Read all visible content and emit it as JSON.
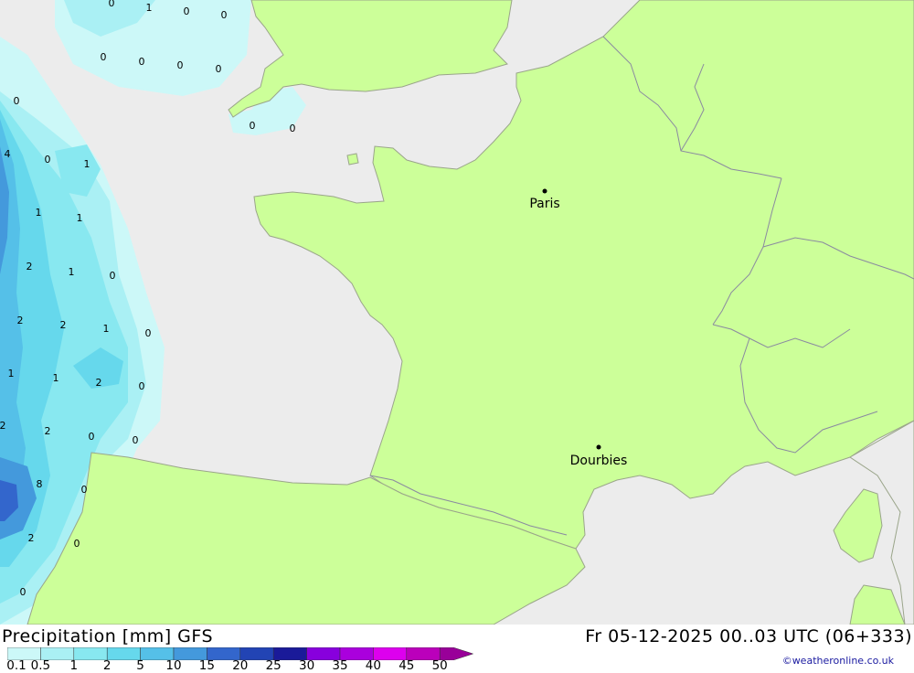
{
  "map": {
    "cities": [
      {
        "name": "Paris"
      },
      {
        "name": "Dourbies"
      }
    ],
    "values": [
      {
        "v": "0"
      },
      {
        "v": "1"
      },
      {
        "v": "0"
      },
      {
        "v": "0"
      },
      {
        "v": "0"
      },
      {
        "v": "0"
      },
      {
        "v": "0"
      },
      {
        "v": "0"
      },
      {
        "v": "0"
      },
      {
        "v": "0"
      },
      {
        "v": "0"
      },
      {
        "v": "4"
      },
      {
        "v": "0"
      },
      {
        "v": "1"
      },
      {
        "v": "1"
      },
      {
        "v": "1"
      },
      {
        "v": "2"
      },
      {
        "v": "1"
      },
      {
        "v": "0"
      },
      {
        "v": "2"
      },
      {
        "v": "2"
      },
      {
        "v": "1"
      },
      {
        "v": "0"
      },
      {
        "v": "1"
      },
      {
        "v": "1"
      },
      {
        "v": "2"
      },
      {
        "v": "0"
      },
      {
        "v": "2"
      },
      {
        "v": "2"
      },
      {
        "v": "0"
      },
      {
        "v": "0"
      },
      {
        "v": "8"
      },
      {
        "v": "0"
      },
      {
        "v": "2"
      },
      {
        "v": "0"
      },
      {
        "v": "0"
      }
    ],
    "colors": {
      "sea": "#ececec",
      "land": "#ccff99",
      "border": "#9aa58a"
    }
  },
  "footer": {
    "title": "Precipitation [mm] GFS",
    "datetime": "Fr 05-12-2025 00..03 UTC (06+333)",
    "copyright": "©weatheronline.co.uk"
  },
  "legend": {
    "labels": [
      "0.1",
      "0.5",
      "1",
      "2",
      "5",
      "10",
      "15",
      "20",
      "25",
      "30",
      "35",
      "40",
      "45",
      "50"
    ],
    "colors": [
      "#ccf8f8",
      "#aaf0f4",
      "#88e8f0",
      "#66d8ec",
      "#55c0e8",
      "#4499dc",
      "#3366cc",
      "#2244b4",
      "#1a1a99",
      "#8800dd",
      "#aa00dd",
      "#dd00ee",
      "#bb00bb",
      "#990099"
    ]
  }
}
